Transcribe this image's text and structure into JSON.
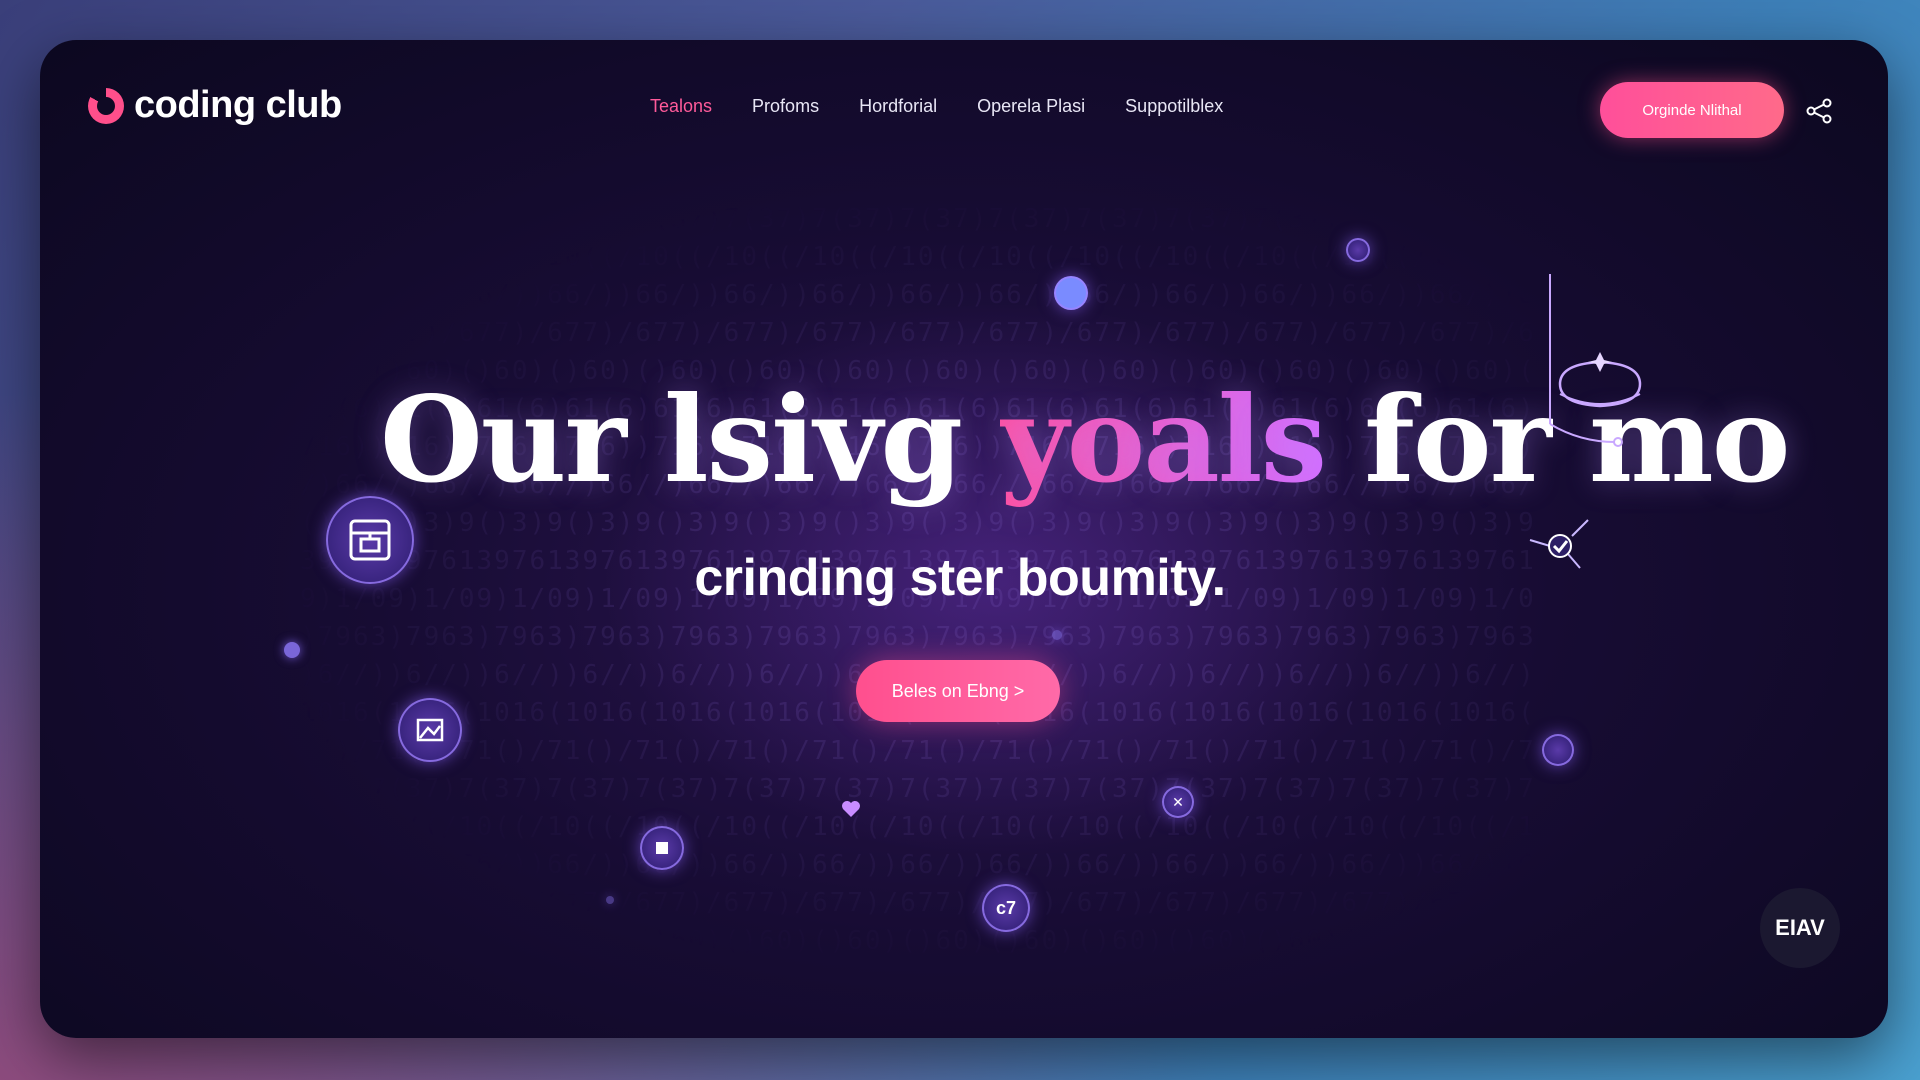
{
  "brand": {
    "name": "coding club",
    "logo_icon": "logo-ring-icon",
    "accent": "#ff4f8b"
  },
  "nav": {
    "items": [
      {
        "label": "Tealons",
        "active": true
      },
      {
        "label": "Profoms",
        "active": false
      },
      {
        "label": "Hordforial",
        "active": false
      },
      {
        "label": "Operela Plasi",
        "active": false
      },
      {
        "label": "Suppotilblex",
        "active": false
      }
    ],
    "cta_label": "Orginde Nlithal",
    "share_icon": "share-icon"
  },
  "hero": {
    "title_part1": "Our lsivg ",
    "title_accent": "yoals",
    "title_part2": " for mo",
    "subtitle": "crinding ster boumity.",
    "button_label": "Beles on Ebng >"
  },
  "badge": {
    "label": "EIAV"
  },
  "floating_icons": {
    "node_7_label": "c7"
  },
  "colors": {
    "background_dark": "#0c0820",
    "accent_pink": "#ff4f9a",
    "accent_violet": "#d46cff"
  }
}
